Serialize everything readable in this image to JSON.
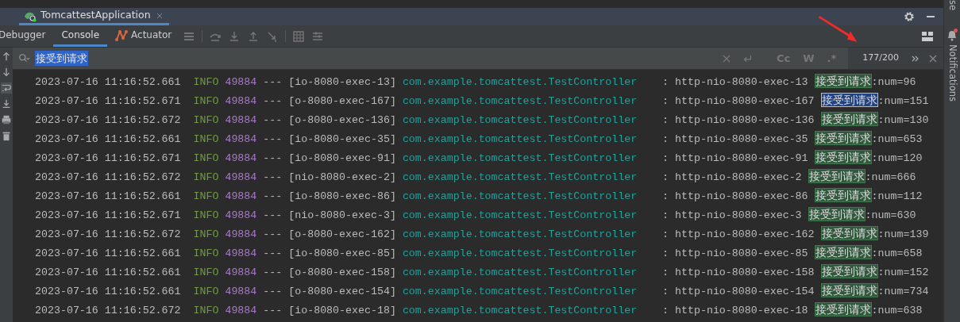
{
  "run_tab": {
    "title": "TomcattestApplication",
    "selected": true
  },
  "tool_tabs": [
    {
      "label": "Debugger",
      "selected": false,
      "kind": "text"
    },
    {
      "label": "Console",
      "selected": true,
      "kind": "text"
    },
    {
      "label": "Actuator",
      "selected": false,
      "kind": "actuator"
    }
  ],
  "search": {
    "query": "接受到请求",
    "match_count": "177/200",
    "options": [
      "Cc",
      "W",
      ".*"
    ]
  },
  "side_panel": {
    "label": "Notifications",
    "top_label": "se"
  },
  "log_rows": [
    {
      "timestamp": "2023-07-16 11:16:52.661",
      "level": "INFO",
      "pid": "49884",
      "separator": "---",
      "thread": "[io-8080-exec-13]",
      "logger": "com.example.tomcattest.TestController",
      "delimiter": ":",
      "message_prefix": "http-nio-8080-exec-13",
      "match": "接受到请求",
      "match_selected": false,
      "message_suffix": ":num=96"
    },
    {
      "timestamp": "2023-07-16 11:16:52.671",
      "level": "INFO",
      "pid": "49884",
      "separator": "---",
      "thread": "[o-8080-exec-167]",
      "logger": "com.example.tomcattest.TestController",
      "delimiter": ":",
      "message_prefix": "http-nio-8080-exec-167",
      "match": "接受到请求",
      "match_selected": true,
      "message_suffix": ":num=151"
    },
    {
      "timestamp": "2023-07-16 11:16:52.672",
      "level": "INFO",
      "pid": "49884",
      "separator": "---",
      "thread": "[o-8080-exec-136]",
      "logger": "com.example.tomcattest.TestController",
      "delimiter": ":",
      "message_prefix": "http-nio-8080-exec-136",
      "match": "接受到请求",
      "match_selected": false,
      "message_suffix": ":num=130"
    },
    {
      "timestamp": "2023-07-16 11:16:52.661",
      "level": "INFO",
      "pid": "49884",
      "separator": "---",
      "thread": "[io-8080-exec-35]",
      "logger": "com.example.tomcattest.TestController",
      "delimiter": ":",
      "message_prefix": "http-nio-8080-exec-35",
      "match": "接受到请求",
      "match_selected": false,
      "message_suffix": ":num=653"
    },
    {
      "timestamp": "2023-07-16 11:16:52.671",
      "level": "INFO",
      "pid": "49884",
      "separator": "---",
      "thread": "[io-8080-exec-91]",
      "logger": "com.example.tomcattest.TestController",
      "delimiter": ":",
      "message_prefix": "http-nio-8080-exec-91",
      "match": "接受到请求",
      "match_selected": false,
      "message_suffix": ":num=120"
    },
    {
      "timestamp": "2023-07-16 11:16:52.672",
      "level": "INFO",
      "pid": "49884",
      "separator": "---",
      "thread": "[nio-8080-exec-2]",
      "logger": "com.example.tomcattest.TestController",
      "delimiter": ":",
      "message_prefix": "http-nio-8080-exec-2",
      "match": "接受到请求",
      "match_selected": false,
      "message_suffix": ":num=666"
    },
    {
      "timestamp": "2023-07-16 11:16:52.661",
      "level": "INFO",
      "pid": "49884",
      "separator": "---",
      "thread": "[io-8080-exec-86]",
      "logger": "com.example.tomcattest.TestController",
      "delimiter": ":",
      "message_prefix": "http-nio-8080-exec-86",
      "match": "接受到请求",
      "match_selected": false,
      "message_suffix": ":num=112"
    },
    {
      "timestamp": "2023-07-16 11:16:52.671",
      "level": "INFO",
      "pid": "49884",
      "separator": "---",
      "thread": "[nio-8080-exec-3]",
      "logger": "com.example.tomcattest.TestController",
      "delimiter": ":",
      "message_prefix": "http-nio-8080-exec-3",
      "match": "接受到请求",
      "match_selected": false,
      "message_suffix": ":num=630"
    },
    {
      "timestamp": "2023-07-16 11:16:52.672",
      "level": "INFO",
      "pid": "49884",
      "separator": "---",
      "thread": "[o-8080-exec-162]",
      "logger": "com.example.tomcattest.TestController",
      "delimiter": ":",
      "message_prefix": "http-nio-8080-exec-162",
      "match": "接受到请求",
      "match_selected": false,
      "message_suffix": ":num=139"
    },
    {
      "timestamp": "2023-07-16 11:16:52.661",
      "level": "INFO",
      "pid": "49884",
      "separator": "---",
      "thread": "[io-8080-exec-85]",
      "logger": "com.example.tomcattest.TestController",
      "delimiter": ":",
      "message_prefix": "http-nio-8080-exec-85",
      "match": "接受到请求",
      "match_selected": false,
      "message_suffix": ":num=658"
    },
    {
      "timestamp": "2023-07-16 11:16:52.661",
      "level": "INFO",
      "pid": "49884",
      "separator": "---",
      "thread": "[o-8080-exec-158]",
      "logger": "com.example.tomcattest.TestController",
      "delimiter": ":",
      "message_prefix": "http-nio-8080-exec-158",
      "match": "接受到请求",
      "match_selected": false,
      "message_suffix": ":num=152"
    },
    {
      "timestamp": "2023-07-16 11:16:52.661",
      "level": "INFO",
      "pid": "49884",
      "separator": "---",
      "thread": "[o-8080-exec-154]",
      "logger": "com.example.tomcattest.TestController",
      "delimiter": ":",
      "message_prefix": "http-nio-8080-exec-154",
      "match": "接受到请求",
      "match_selected": false,
      "message_suffix": ":num=734"
    },
    {
      "timestamp": "2023-07-16 11:16:52.672",
      "level": "INFO",
      "pid": "49884",
      "separator": "---",
      "thread": "[io-8080-exec-18]",
      "logger": "com.example.tomcattest.TestController",
      "delimiter": ":",
      "message_prefix": "http-nio-8080-exec-18",
      "match": "接受到请求",
      "match_selected": false,
      "message_suffix": ":num=638"
    }
  ]
}
